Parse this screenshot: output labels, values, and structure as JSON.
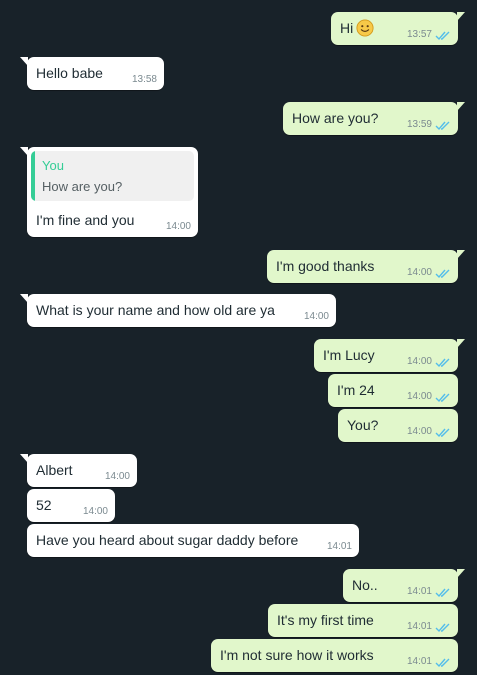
{
  "colors": {
    "background": "#182229",
    "outgoing_bubble": "#e1f7cb",
    "incoming_bubble": "#ffffff",
    "read_ticks": "#53bdeb",
    "quote_accent": "#35cd96"
  },
  "messages": [
    {
      "direction": "outgoing",
      "text": "Hi",
      "emoji": "slightly-smiling-face-icon",
      "time": "13:57",
      "status": "read"
    },
    {
      "direction": "incoming",
      "text": "Hello babe",
      "time": "13:58"
    },
    {
      "direction": "outgoing",
      "text": "How are you?",
      "time": "13:59",
      "status": "read"
    },
    {
      "direction": "incoming",
      "reply_to": {
        "author": "You",
        "text": "How are you?"
      },
      "text": "I'm fine and you",
      "time": "14:00"
    },
    {
      "direction": "outgoing",
      "text": "I'm good thanks",
      "time": "14:00",
      "status": "read"
    },
    {
      "direction": "incoming",
      "text": "What is your name and how old are ya",
      "time": "14:00"
    },
    {
      "direction": "outgoing",
      "text": "I'm Lucy",
      "time": "14:00",
      "status": "read"
    },
    {
      "direction": "outgoing",
      "text": "I'm 24",
      "time": "14:00",
      "status": "read"
    },
    {
      "direction": "outgoing",
      "text": "You?",
      "time": "14:00",
      "status": "read"
    },
    {
      "direction": "incoming",
      "text": "Albert",
      "time": "14:00"
    },
    {
      "direction": "incoming",
      "text": "52",
      "time": "14:00"
    },
    {
      "direction": "incoming",
      "text": "Have you heard about sugar daddy before",
      "time": "14:01"
    },
    {
      "direction": "outgoing",
      "text": "No..",
      "time": "14:01",
      "status": "read"
    },
    {
      "direction": "outgoing",
      "text": "It's my first time",
      "time": "14:01",
      "status": "read"
    },
    {
      "direction": "outgoing",
      "text": "I'm not sure how it works",
      "time": "14:01",
      "status": "read"
    }
  ]
}
